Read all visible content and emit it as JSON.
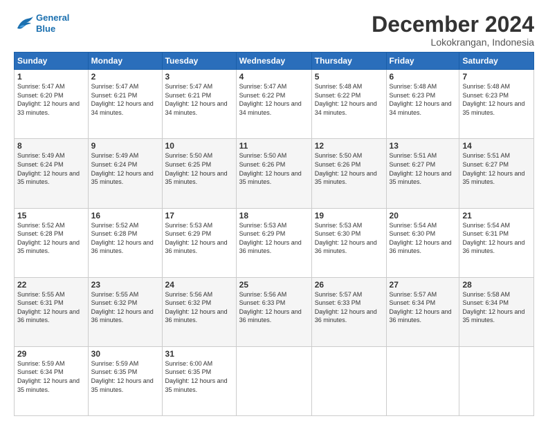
{
  "logo": {
    "line1": "General",
    "line2": "Blue"
  },
  "title": "December 2024",
  "location": "Lokokrangan, Indonesia",
  "days_header": [
    "Sunday",
    "Monday",
    "Tuesday",
    "Wednesday",
    "Thursday",
    "Friday",
    "Saturday"
  ],
  "weeks": [
    [
      {
        "day": "1",
        "sunrise": "5:47 AM",
        "sunset": "6:20 PM",
        "daylight": "12 hours and 33 minutes."
      },
      {
        "day": "2",
        "sunrise": "5:47 AM",
        "sunset": "6:21 PM",
        "daylight": "12 hours and 34 minutes."
      },
      {
        "day": "3",
        "sunrise": "5:47 AM",
        "sunset": "6:21 PM",
        "daylight": "12 hours and 34 minutes."
      },
      {
        "day": "4",
        "sunrise": "5:47 AM",
        "sunset": "6:22 PM",
        "daylight": "12 hours and 34 minutes."
      },
      {
        "day": "5",
        "sunrise": "5:48 AM",
        "sunset": "6:22 PM",
        "daylight": "12 hours and 34 minutes."
      },
      {
        "day": "6",
        "sunrise": "5:48 AM",
        "sunset": "6:23 PM",
        "daylight": "12 hours and 34 minutes."
      },
      {
        "day": "7",
        "sunrise": "5:48 AM",
        "sunset": "6:23 PM",
        "daylight": "12 hours and 35 minutes."
      }
    ],
    [
      {
        "day": "8",
        "sunrise": "5:49 AM",
        "sunset": "6:24 PM",
        "daylight": "12 hours and 35 minutes."
      },
      {
        "day": "9",
        "sunrise": "5:49 AM",
        "sunset": "6:24 PM",
        "daylight": "12 hours and 35 minutes."
      },
      {
        "day": "10",
        "sunrise": "5:50 AM",
        "sunset": "6:25 PM",
        "daylight": "12 hours and 35 minutes."
      },
      {
        "day": "11",
        "sunrise": "5:50 AM",
        "sunset": "6:26 PM",
        "daylight": "12 hours and 35 minutes."
      },
      {
        "day": "12",
        "sunrise": "5:50 AM",
        "sunset": "6:26 PM",
        "daylight": "12 hours and 35 minutes."
      },
      {
        "day": "13",
        "sunrise": "5:51 AM",
        "sunset": "6:27 PM",
        "daylight": "12 hours and 35 minutes."
      },
      {
        "day": "14",
        "sunrise": "5:51 AM",
        "sunset": "6:27 PM",
        "daylight": "12 hours and 35 minutes."
      }
    ],
    [
      {
        "day": "15",
        "sunrise": "5:52 AM",
        "sunset": "6:28 PM",
        "daylight": "12 hours and 35 minutes."
      },
      {
        "day": "16",
        "sunrise": "5:52 AM",
        "sunset": "6:28 PM",
        "daylight": "12 hours and 36 minutes."
      },
      {
        "day": "17",
        "sunrise": "5:53 AM",
        "sunset": "6:29 PM",
        "daylight": "12 hours and 36 minutes."
      },
      {
        "day": "18",
        "sunrise": "5:53 AM",
        "sunset": "6:29 PM",
        "daylight": "12 hours and 36 minutes."
      },
      {
        "day": "19",
        "sunrise": "5:53 AM",
        "sunset": "6:30 PM",
        "daylight": "12 hours and 36 minutes."
      },
      {
        "day": "20",
        "sunrise": "5:54 AM",
        "sunset": "6:30 PM",
        "daylight": "12 hours and 36 minutes."
      },
      {
        "day": "21",
        "sunrise": "5:54 AM",
        "sunset": "6:31 PM",
        "daylight": "12 hours and 36 minutes."
      }
    ],
    [
      {
        "day": "22",
        "sunrise": "5:55 AM",
        "sunset": "6:31 PM",
        "daylight": "12 hours and 36 minutes."
      },
      {
        "day": "23",
        "sunrise": "5:55 AM",
        "sunset": "6:32 PM",
        "daylight": "12 hours and 36 minutes."
      },
      {
        "day": "24",
        "sunrise": "5:56 AM",
        "sunset": "6:32 PM",
        "daylight": "12 hours and 36 minutes."
      },
      {
        "day": "25",
        "sunrise": "5:56 AM",
        "sunset": "6:33 PM",
        "daylight": "12 hours and 36 minutes."
      },
      {
        "day": "26",
        "sunrise": "5:57 AM",
        "sunset": "6:33 PM",
        "daylight": "12 hours and 36 minutes."
      },
      {
        "day": "27",
        "sunrise": "5:57 AM",
        "sunset": "6:34 PM",
        "daylight": "12 hours and 36 minutes."
      },
      {
        "day": "28",
        "sunrise": "5:58 AM",
        "sunset": "6:34 PM",
        "daylight": "12 hours and 35 minutes."
      }
    ],
    [
      {
        "day": "29",
        "sunrise": "5:59 AM",
        "sunset": "6:34 PM",
        "daylight": "12 hours and 35 minutes."
      },
      {
        "day": "30",
        "sunrise": "5:59 AM",
        "sunset": "6:35 PM",
        "daylight": "12 hours and 35 minutes."
      },
      {
        "day": "31",
        "sunrise": "6:00 AM",
        "sunset": "6:35 PM",
        "daylight": "12 hours and 35 minutes."
      },
      {
        "day": "",
        "sunrise": "",
        "sunset": "",
        "daylight": ""
      },
      {
        "day": "",
        "sunrise": "",
        "sunset": "",
        "daylight": ""
      },
      {
        "day": "",
        "sunrise": "",
        "sunset": "",
        "daylight": ""
      },
      {
        "day": "",
        "sunrise": "",
        "sunset": "",
        "daylight": ""
      }
    ]
  ]
}
